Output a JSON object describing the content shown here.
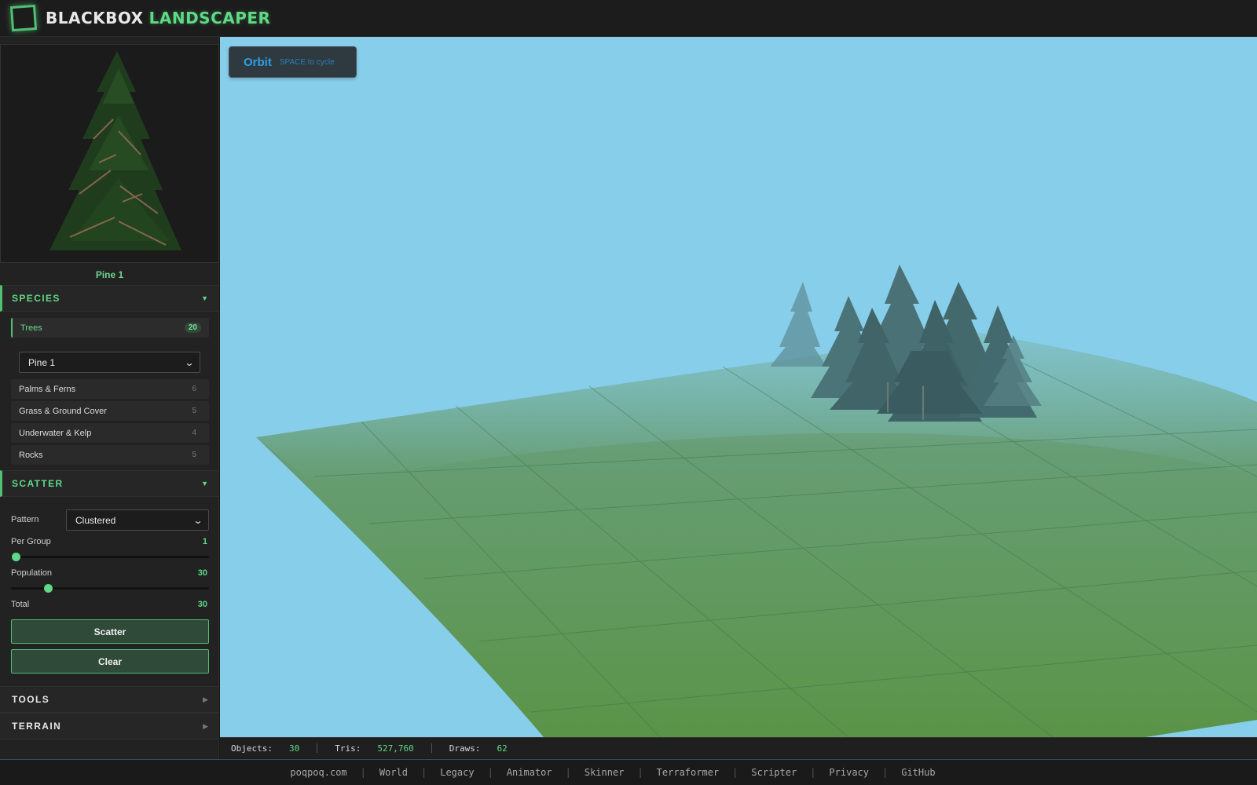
{
  "app": {
    "brand_part1": "BLACKBOX",
    "brand_part2": "LANDSCAPER"
  },
  "preview": {
    "name": "Pine 1"
  },
  "species": {
    "title": "SPECIES",
    "categories": [
      {
        "label": "Trees",
        "count": "20"
      },
      {
        "label": "Palms & Ferns",
        "count": "6"
      },
      {
        "label": "Grass & Ground Cover",
        "count": "5"
      },
      {
        "label": "Underwater & Kelp",
        "count": "4"
      },
      {
        "label": "Rocks",
        "count": "5"
      }
    ],
    "selected_species": "Pine 1"
  },
  "scatter": {
    "title": "SCATTER",
    "pattern_label": "Pattern",
    "pattern_value": "Clustered",
    "per_group_label": "Per Group",
    "per_group_value": "1",
    "per_group_fraction": 0.0,
    "population_label": "Population",
    "population_value": "30",
    "population_fraction": 0.17,
    "total_label": "Total",
    "total_value": "30",
    "scatter_button": "Scatter",
    "clear_button": "Clear"
  },
  "tools": {
    "title": "TOOLS"
  },
  "terrain": {
    "title": "TERRAIN"
  },
  "viewport": {
    "mode": "Orbit",
    "mode_hint": "SPACE to cycle"
  },
  "stats": {
    "objects_label": "Objects:",
    "objects_value": "30",
    "tris_label": "Tris:",
    "tris_value": "527,760",
    "draws_label": "Draws:",
    "draws_value": "62"
  },
  "footer": {
    "links": [
      "poqpoq.com",
      "World",
      "Legacy",
      "Animator",
      "Skinner",
      "Terraformer",
      "Scripter",
      "Privacy",
      "GitHub"
    ],
    "separator": "|"
  },
  "colors": {
    "accent": "#5fd985",
    "sky": "#87ceeb",
    "ground": "#5e9650",
    "mode_text": "#2f9fe8"
  }
}
